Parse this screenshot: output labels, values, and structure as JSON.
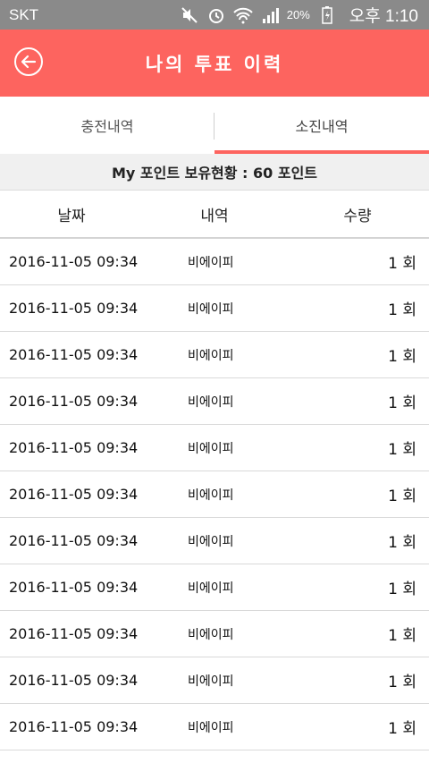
{
  "status_bar": {
    "carrier": "SKT",
    "battery_percent": "20%",
    "time": "오후 1:10",
    "icons": [
      "mute-icon",
      "alarm-icon",
      "wifi-icon",
      "signal-icon",
      "battery-charging-icon"
    ]
  },
  "app_bar": {
    "title": "나의 투표 이력",
    "back_icon": "back-arrow-icon",
    "background": "#fd645f"
  },
  "tabs": [
    {
      "label": "충전내역",
      "active": false
    },
    {
      "label": "소진내역",
      "active": true
    }
  ],
  "points": {
    "text": "My 포인트 보유현황 : 60 포인트"
  },
  "table": {
    "headers": {
      "date": "날짜",
      "detail": "내역",
      "quantity": "수량"
    },
    "rows": [
      {
        "date": "2016-11-05 09:34",
        "detail": "비에이피",
        "quantity": "1 회"
      },
      {
        "date": "2016-11-05 09:34",
        "detail": "비에이피",
        "quantity": "1 회"
      },
      {
        "date": "2016-11-05 09:34",
        "detail": "비에이피",
        "quantity": "1 회"
      },
      {
        "date": "2016-11-05 09:34",
        "detail": "비에이피",
        "quantity": "1 회"
      },
      {
        "date": "2016-11-05 09:34",
        "detail": "비에이피",
        "quantity": "1 회"
      },
      {
        "date": "2016-11-05 09:34",
        "detail": "비에이피",
        "quantity": "1 회"
      },
      {
        "date": "2016-11-05 09:34",
        "detail": "비에이피",
        "quantity": "1 회"
      },
      {
        "date": "2016-11-05 09:34",
        "detail": "비에이피",
        "quantity": "1 회"
      },
      {
        "date": "2016-11-05 09:34",
        "detail": "비에이피",
        "quantity": "1 회"
      },
      {
        "date": "2016-11-05 09:34",
        "detail": "비에이피",
        "quantity": "1 회"
      },
      {
        "date": "2016-11-05 09:34",
        "detail": "비에이피",
        "quantity": "1 회"
      }
    ]
  }
}
